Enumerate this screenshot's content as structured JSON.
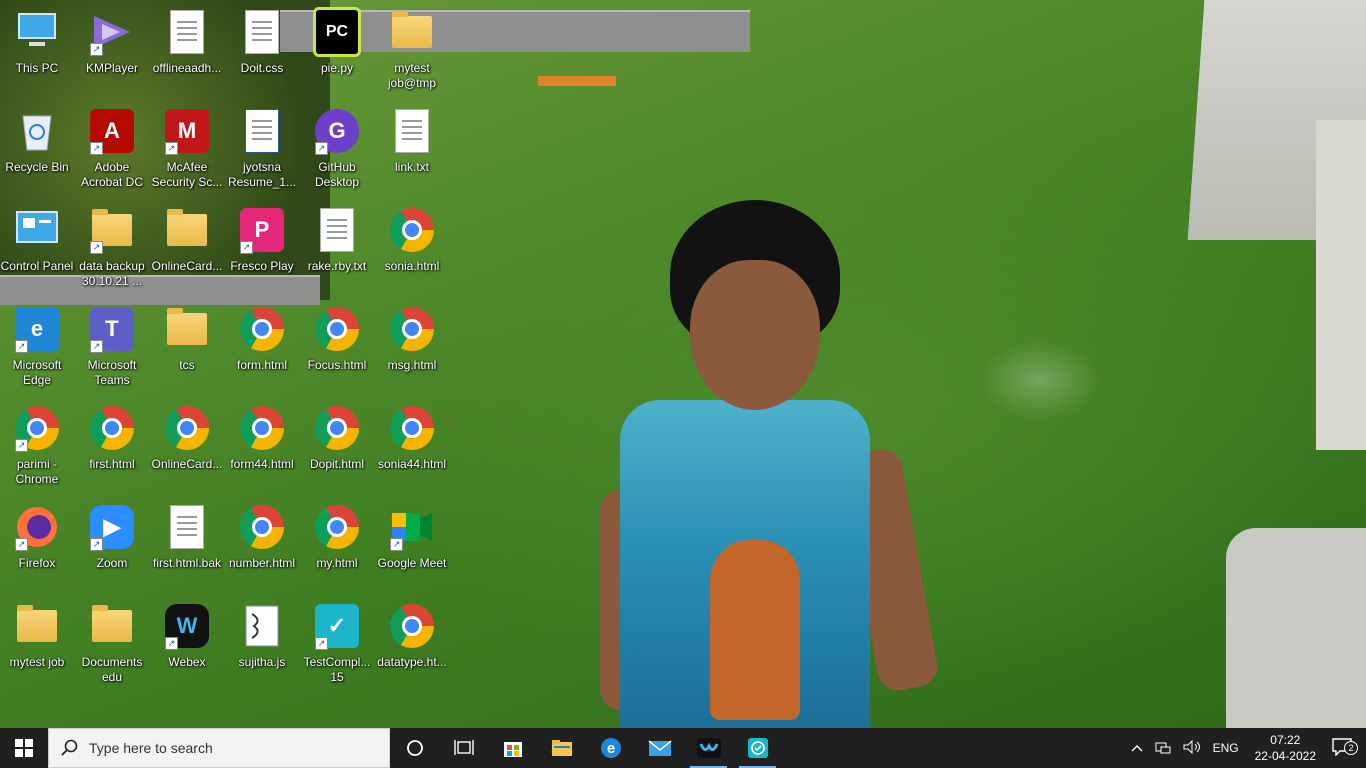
{
  "desktop": {
    "icons": [
      {
        "label": "This PC",
        "type": "pc",
        "name": "this-pc"
      },
      {
        "label": "KMPlayer",
        "type": "kmp",
        "name": "kmplayer",
        "shortcut": true
      },
      {
        "label": "offlineaadh...",
        "type": "doc",
        "name": "offlineaadhaar"
      },
      {
        "label": "Doit.css",
        "type": "doc",
        "name": "doit-css"
      },
      {
        "label": "pie.py",
        "type": "pycharm",
        "name": "pie-py"
      },
      {
        "label": "mytest job@tmp",
        "type": "folder",
        "name": "mytest-job-tmp"
      },
      {
        "label": "Recycle Bin",
        "type": "bin",
        "name": "recycle-bin"
      },
      {
        "label": "Adobe Acrobat DC",
        "type": "adobe",
        "name": "adobe-acrobat",
        "shortcut": true
      },
      {
        "label": "McAfee Security Sc...",
        "type": "mcafee",
        "name": "mcafee",
        "shortcut": true
      },
      {
        "label": "jyotsna Resume_1...",
        "type": "word",
        "name": "jyotsna-resume"
      },
      {
        "label": "GitHub Desktop",
        "type": "github",
        "name": "github-desktop",
        "shortcut": true
      },
      {
        "label": "link.txt",
        "type": "doc",
        "name": "link-txt"
      },
      {
        "label": "Control Panel",
        "type": "cp",
        "name": "control-panel"
      },
      {
        "label": "data backup 30.10.21 ...",
        "type": "folder",
        "name": "data-backup",
        "shortcut": true
      },
      {
        "label": "OnlineCard...",
        "type": "folder",
        "name": "onlinecard-folder"
      },
      {
        "label": "Fresco Play",
        "type": "fresco",
        "name": "fresco-play",
        "shortcut": true
      },
      {
        "label": "rake.rby.txt",
        "type": "doc",
        "name": "rake-txt"
      },
      {
        "label": "sonia.html",
        "type": "chrome",
        "name": "sonia-html"
      },
      {
        "label": "Microsoft Edge",
        "type": "edge",
        "name": "microsoft-edge",
        "shortcut": true
      },
      {
        "label": "Microsoft Teams",
        "type": "teams",
        "name": "microsoft-teams",
        "shortcut": true
      },
      {
        "label": "tcs",
        "type": "folder",
        "name": "tcs"
      },
      {
        "label": "form.html",
        "type": "chrome",
        "name": "form-html"
      },
      {
        "label": "Focus.html",
        "type": "chrome",
        "name": "focus-html"
      },
      {
        "label": "msg.html",
        "type": "chrome",
        "name": "msg-html"
      },
      {
        "label": "parimi - Chrome",
        "type": "chrome",
        "name": "parimi-chrome",
        "shortcut": true
      },
      {
        "label": "first.html",
        "type": "chrome",
        "name": "first-html"
      },
      {
        "label": "OnlineCard...",
        "type": "chrome",
        "name": "onlinecard-html"
      },
      {
        "label": "form44.html",
        "type": "chrome",
        "name": "form44-html"
      },
      {
        "label": "Dopit.html",
        "type": "chrome",
        "name": "dopit-html"
      },
      {
        "label": "sonia44.html",
        "type": "chrome",
        "name": "sonia44-html"
      },
      {
        "label": "Firefox",
        "type": "firefox",
        "name": "firefox",
        "shortcut": true
      },
      {
        "label": "Zoom",
        "type": "zoom",
        "name": "zoom",
        "shortcut": true
      },
      {
        "label": "first.html.bak",
        "type": "blank",
        "name": "first-html-bak"
      },
      {
        "label": "number.html",
        "type": "chrome",
        "name": "number-html"
      },
      {
        "label": "my.html",
        "type": "chrome",
        "name": "my-html"
      },
      {
        "label": "Google Meet",
        "type": "meet",
        "name": "google-meet",
        "shortcut": true
      },
      {
        "label": "mytest job",
        "type": "folder",
        "name": "mytest-job"
      },
      {
        "label": "Documents edu",
        "type": "folder",
        "name": "documents-edu"
      },
      {
        "label": "Webex",
        "type": "webex",
        "name": "webex",
        "shortcut": true
      },
      {
        "label": "sujitha.js",
        "type": "js",
        "name": "sujitha-js"
      },
      {
        "label": "TestCompl... 15",
        "type": "testc",
        "name": "testcomplete",
        "shortcut": true
      },
      {
        "label": "datatype.ht...",
        "type": "chrome",
        "name": "datatype-html"
      }
    ]
  },
  "taskbar": {
    "search_placeholder": "Type here to search",
    "language": "ENG",
    "time": "07:22",
    "date": "22-04-2022",
    "notification_count": "2",
    "pinned": [
      "task-view",
      "widgets",
      "microsoft-store",
      "file-explorer",
      "microsoft-edge",
      "mail",
      "webex",
      "testcomplete"
    ]
  },
  "colors": {
    "taskbar_bg": "#202020",
    "accent": "#76b9ed"
  }
}
